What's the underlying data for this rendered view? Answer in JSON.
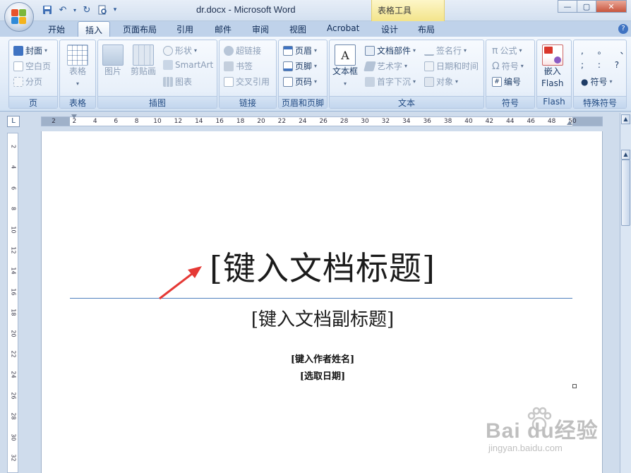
{
  "window": {
    "title": "dr.docx - Microsoft Word",
    "context_tab_group": "表格工具"
  },
  "tabs": [
    {
      "label": "开始"
    },
    {
      "label": "插入",
      "active": true
    },
    {
      "label": "页面布局"
    },
    {
      "label": "引用"
    },
    {
      "label": "邮件"
    },
    {
      "label": "审阅"
    },
    {
      "label": "视图"
    },
    {
      "label": "Acrobat"
    },
    {
      "label": "设计"
    },
    {
      "label": "布局"
    }
  ],
  "ribbon": {
    "page": {
      "label": "页",
      "items": [
        "封面",
        "空白页",
        "分页"
      ]
    },
    "table": {
      "label": "表格",
      "button": "表格"
    },
    "illustrations": {
      "label": "插图",
      "picture": "图片",
      "clipart": "剪贴画",
      "shapes": "形状",
      "smartart": "SmartArt",
      "chart": "图表"
    },
    "links": {
      "label": "链接",
      "hyperlink": "超链接",
      "bookmark": "书签",
      "crossref": "交叉引用"
    },
    "header_footer": {
      "label": "页眉和页脚",
      "header": "页眉",
      "footer": "页脚",
      "page_number": "页码"
    },
    "text": {
      "label": "文本",
      "textbox": "文本框",
      "quickparts": "文档部件",
      "wordart": "艺术字",
      "dropcap": "首字下沉",
      "signature": "签名行",
      "datetime": "日期和时间",
      "object": "对象"
    },
    "symbols": {
      "label": "符号",
      "equation": "公式",
      "symbol": "符号",
      "numbering": "编号"
    },
    "flash": {
      "label": "Flash",
      "button_line1": "嵌入",
      "button_line2": "Flash"
    },
    "special": {
      "label": "特殊符号",
      "symbol": "符号",
      "chars_row1": ", 。 、",
      "chars_row2": "; : ?"
    }
  },
  "ruler": {
    "horizontal_ticks": [
      "2",
      "2",
      "4",
      "6",
      "8",
      "10",
      "12",
      "14",
      "16",
      "18",
      "20",
      "22",
      "24",
      "26",
      "28",
      "30",
      "32",
      "34",
      "36",
      "38",
      "40",
      "42",
      "44",
      "46",
      "48",
      "50"
    ],
    "vertical_ticks": [
      "2",
      "4",
      "6",
      "8",
      "10",
      "12",
      "14",
      "16",
      "18",
      "20",
      "22",
      "24",
      "26",
      "28",
      "30",
      "32",
      "34"
    ]
  },
  "document": {
    "title_placeholder": "[键入文档标题]",
    "subtitle_placeholder": "[键入文档副标题]",
    "author_placeholder": "[键入作者姓名]",
    "date_placeholder": "[选取日期]"
  },
  "watermark": {
    "logo": "Bai du经验",
    "site": "jingyan.baidu.com"
  },
  "colors": {
    "accent_line": "#4f81bd",
    "annotation_arrow": "#e53935"
  }
}
